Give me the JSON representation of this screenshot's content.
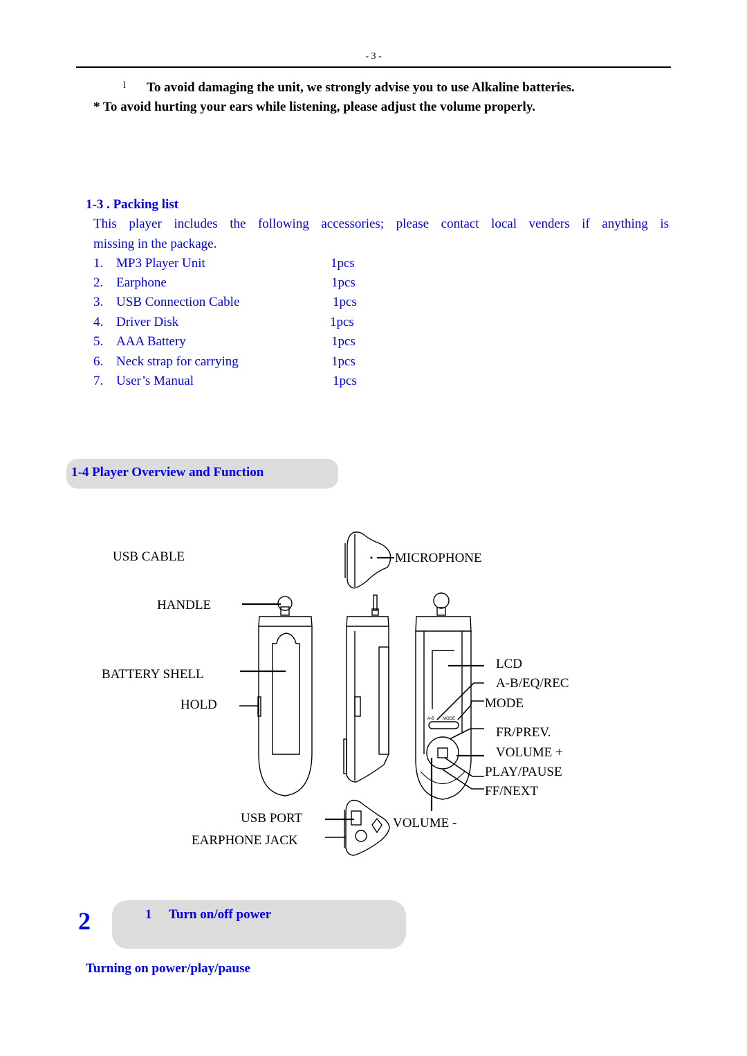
{
  "page": {
    "number": "- 3 -"
  },
  "warnings": {
    "bullet_glyph": "l",
    "alkaline": "To avoid damaging the unit, we strongly advise you to use Alkaline batteries.",
    "volume": "* To avoid hurting your ears while listening, please adjust the volume properly."
  },
  "packing": {
    "heading": "1-3 . Packing list",
    "intro_line1": "This player includes the following accessories; please contact local venders if anything is",
    "intro_line2": "missing in the package.",
    "items": [
      {
        "num": "1.",
        "name": "MP3 Player Unit",
        "qty": "1pcs"
      },
      {
        "num": "2.",
        "name": "Earphone",
        "qty": "1pcs"
      },
      {
        "num": "3.",
        "name": "USB Connection Cable",
        "qty": "1pcs"
      },
      {
        "num": "4.",
        "name": "Driver Disk",
        "qty": "1pcs"
      },
      {
        "num": "5.",
        "name": "AAA Battery",
        "qty": "1pcs"
      },
      {
        "num": "6.",
        "name": "Neck strap for carrying",
        "qty": "1pcs"
      },
      {
        "num": "7.",
        "name": "User’s Manual",
        "qty": "1pcs"
      }
    ]
  },
  "overview": {
    "heading": "1-4 Player Overview and Function",
    "labels": {
      "usb_cable": "USB CABLE",
      "microphone": "MICROPHONE",
      "handle": "HANDLE",
      "battery_shell": "BATTERY SHELL",
      "hold": "HOLD",
      "lcd": "LCD",
      "ab_eq_rec": "A-B/EQ/REC",
      "mode": "MODE",
      "fr_prev": "FR/PREV.",
      "volume_plus": "VOLUME +",
      "play_pause": "PLAY/PAUSE",
      "ff_next": "FF/NEXT",
      "usb_port": "USB PORT",
      "earphone_jack": "EARPHONE JACK",
      "volume_minus": "VOLUME -"
    },
    "device_button_text": {
      "ab": "A-B",
      "mode": "MODE"
    }
  },
  "section2": {
    "chapter_number": "2",
    "sub_number": "1",
    "title": "Turn on/off power",
    "subheading": "Turning on power/play/pause"
  }
}
